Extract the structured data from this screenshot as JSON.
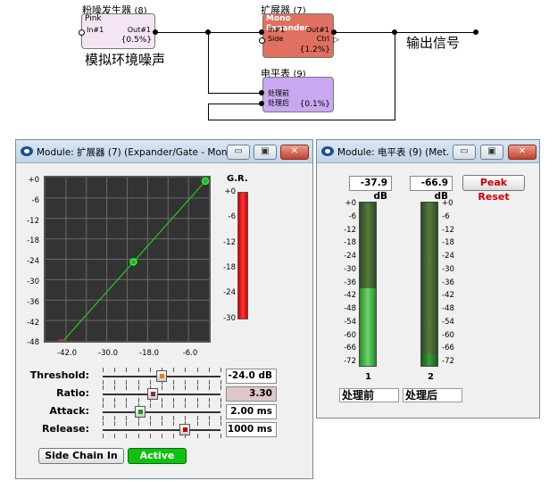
{
  "diagram": {
    "pink_block": {
      "title": "粉噪发生器",
      "num": "(8)",
      "name": "Pink",
      "in": "In#1",
      "out": "Out#1",
      "pct": "{0.5%}"
    },
    "expander_block": {
      "title": "扩展器",
      "num": "(7)",
      "name": "Mono Expander",
      "in": "In#1",
      "side": "Side",
      "out": "Out#1",
      "ctrl": "Ctrl",
      "pct": "{1.2%}"
    },
    "meter_block": {
      "title": "电平表",
      "num": "(9)",
      "in1": "处理前",
      "in2": "处理后",
      "pct": "{0.1%}"
    },
    "caption_noise": "模拟环境噪声",
    "caption_output": "输出信号"
  },
  "expander_window": {
    "title": "Module: 扩展器 (7) (Expander/Gate - Mon...",
    "graph": {
      "y_ticks": [
        "+0",
        "-6",
        "-12",
        "-18",
        "-24",
        "-30",
        "-36",
        "-42",
        "-48"
      ],
      "x_ticks": [
        "-42.0",
        "-30.0",
        "-18.0",
        "-6.0"
      ],
      "curve_points": [
        [
          -48,
          -48
        ],
        [
          -24,
          -24
        ],
        [
          0,
          0
        ]
      ]
    },
    "gr": {
      "label": "G.R.",
      "ticks": [
        "+0",
        "-6",
        "-12",
        "-18",
        "-24",
        "-30"
      ]
    },
    "params": [
      {
        "label": "Threshold:",
        "value": "-24.0 dB",
        "pos": 0.5
      },
      {
        "label": "Ratio:",
        "value": "3.30",
        "pos": 0.42
      },
      {
        "label": "Attack:",
        "value": "2.00 ms",
        "pos": 0.3
      },
      {
        "label": "Release:",
        "value": "1000 ms",
        "pos": 0.72
      }
    ],
    "side_chain_label": "Side Chain In",
    "active_label": "Active"
  },
  "meter_window": {
    "title": "Module: 电平表 (9) (Met...",
    "readout1": "-37.9 dB",
    "readout2": "-66.9 dB",
    "peak_reset": "Peak Reset",
    "scale": [
      "+0",
      "-6",
      "-12",
      "-18",
      "-24",
      "-30",
      "-36",
      "-42",
      "-48",
      "-54",
      "-60",
      "-66",
      "-72"
    ],
    "ch1_num": "1",
    "ch2_num": "2",
    "ch1_label": "处理前",
    "ch2_label": "处理后",
    "ch1_level_db": -37.9,
    "ch2_level_db": -66.9
  },
  "colors": {
    "pink": "#f3e6f2",
    "expander": "#e07060",
    "meter": "#c8a8f0",
    "curve": "#22c822",
    "active": "#10c010"
  }
}
